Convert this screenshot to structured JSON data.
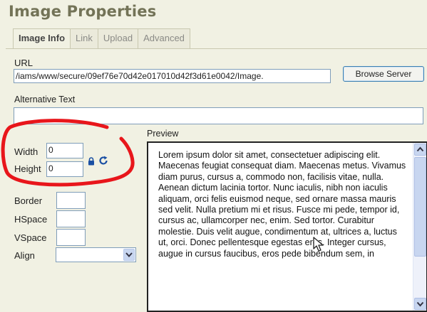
{
  "dialog": {
    "title": "Image Properties"
  },
  "tabs": [
    {
      "label": "Image Info",
      "active": true
    },
    {
      "label": "Link",
      "active": false
    },
    {
      "label": "Upload",
      "active": false
    },
    {
      "label": "Advanced",
      "active": false
    }
  ],
  "url": {
    "label": "URL",
    "value": "/iams/www/secure/09ef76e70d42e017010d42f3d61e0042/Image.",
    "browse_label": "Browse Server"
  },
  "alt_text": {
    "label": "Alternative Text",
    "value": ""
  },
  "dimensions": {
    "width_label": "Width",
    "width_value": "0",
    "height_label": "Height",
    "height_value": "0"
  },
  "spacing": {
    "border_label": "Border",
    "border_value": "",
    "hspace_label": "HSpace",
    "hspace_value": "",
    "vspace_label": "VSpace",
    "vspace_value": ""
  },
  "align": {
    "label": "Align",
    "value": ""
  },
  "preview": {
    "label": "Preview",
    "text": "Lorem ipsum dolor sit amet, consectetuer adipiscing elit. Maecenas feugiat consequat diam. Maecenas metus. Vivamus diam purus, cursus a, commodo non, facilisis vitae, nulla. Aenean dictum lacinia tortor. Nunc iaculis, nibh non iaculis aliquam, orci felis euismod neque, sed ornare massa mauris sed velit. Nulla pretium mi et risus. Fusce mi pede, tempor id, cursus ac, ullamcorper nec, enim. Sed tortor. Curabitur molestie. Duis velit augue, condimentum at, ultrices a, luctus ut, orci. Donec pellentesque egestas eros. Integer cursus, augue in cursus faucibus, eros pede bibendum sem, in"
  },
  "colors": {
    "title": "#737357",
    "background": "#f1f1e3",
    "annotation": "#e8161b",
    "field_border": "#7f9db9"
  },
  "icons": {
    "lock": "lock-icon",
    "reset": "reset-size-icon",
    "dropdown": "chevron-down-icon",
    "cursor": "cursor-icon"
  }
}
